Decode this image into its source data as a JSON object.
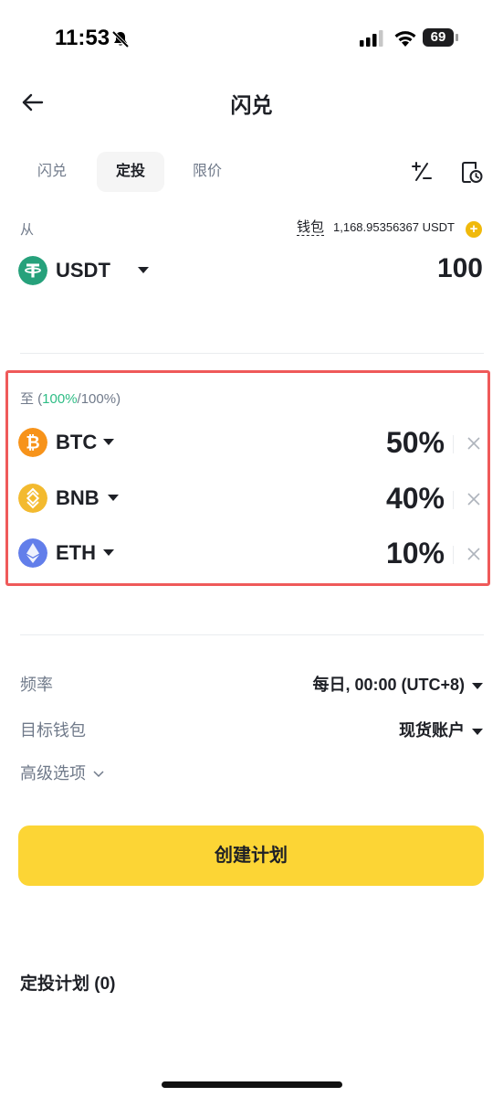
{
  "status_bar": {
    "time": "11:53",
    "battery": "69"
  },
  "header": {
    "title": "闪兑"
  },
  "tabs": [
    {
      "label": "闪兑",
      "active": false
    },
    {
      "label": "定投",
      "active": true
    },
    {
      "label": "限价",
      "active": false
    }
  ],
  "from": {
    "label": "从",
    "wallet_label": "钱包",
    "wallet_balance": "1,168.95356367 USDT",
    "coin": "USDT",
    "amount": "100"
  },
  "to": {
    "label_prefix": "至 (",
    "allocated": "100%",
    "total": "/100%)",
    "items": [
      {
        "coin": "BTC",
        "percent": "50%",
        "color": "#f7931a",
        "icon": "bitcoin-icon"
      },
      {
        "coin": "BNB",
        "percent": "40%",
        "color": "#f3ba2f",
        "icon": "bnb-icon"
      },
      {
        "coin": "ETH",
        "percent": "10%",
        "color": "#627eea",
        "icon": "ethereum-icon"
      }
    ]
  },
  "settings": {
    "frequency_label": "频率",
    "frequency_value": "每日, 00:00 (UTC+8)",
    "wallet_label": "目标钱包",
    "wallet_value": "现货账户",
    "advanced_label": "高级选项"
  },
  "create_button": "创建计划",
  "plans_title": "定投计划 (0)",
  "colors": {
    "accent_yellow": "#fcd535",
    "highlight_border": "#ef5a5a",
    "green": "#2ebd85",
    "usdt": "#26a17b"
  }
}
